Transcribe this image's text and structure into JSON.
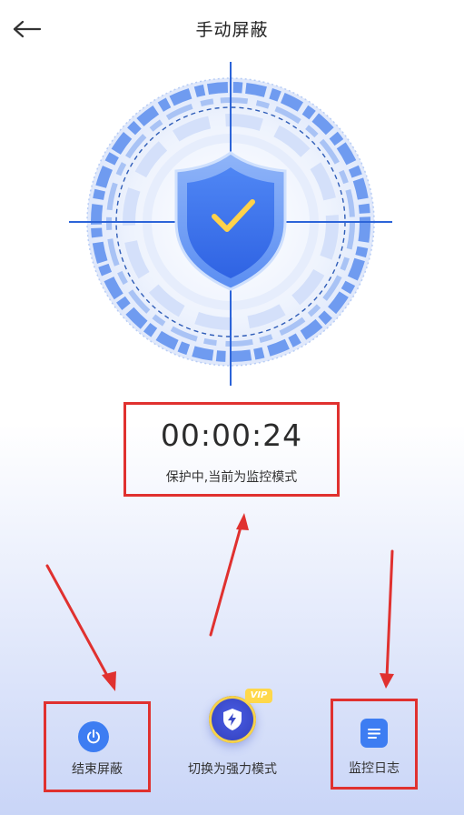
{
  "header": {
    "title": "手动屏蔽"
  },
  "timer": {
    "elapsed": "00:00:24",
    "status": "保护中,当前为监控模式"
  },
  "actions": {
    "end_label": "结束屏蔽",
    "switch_label": "切换为强力模式",
    "switch_badge": "VIP",
    "log_label": "监控日志"
  },
  "icons": {
    "back": "back-arrow-icon",
    "shield": "shield-check-icon",
    "power": "power-icon",
    "bolt_shield": "bolt-shield-icon",
    "log": "document-list-icon"
  },
  "colors": {
    "accent_blue": "#3d7df2",
    "highlight_red": "#e0312f",
    "vip_yellow": "#ffd84a"
  }
}
